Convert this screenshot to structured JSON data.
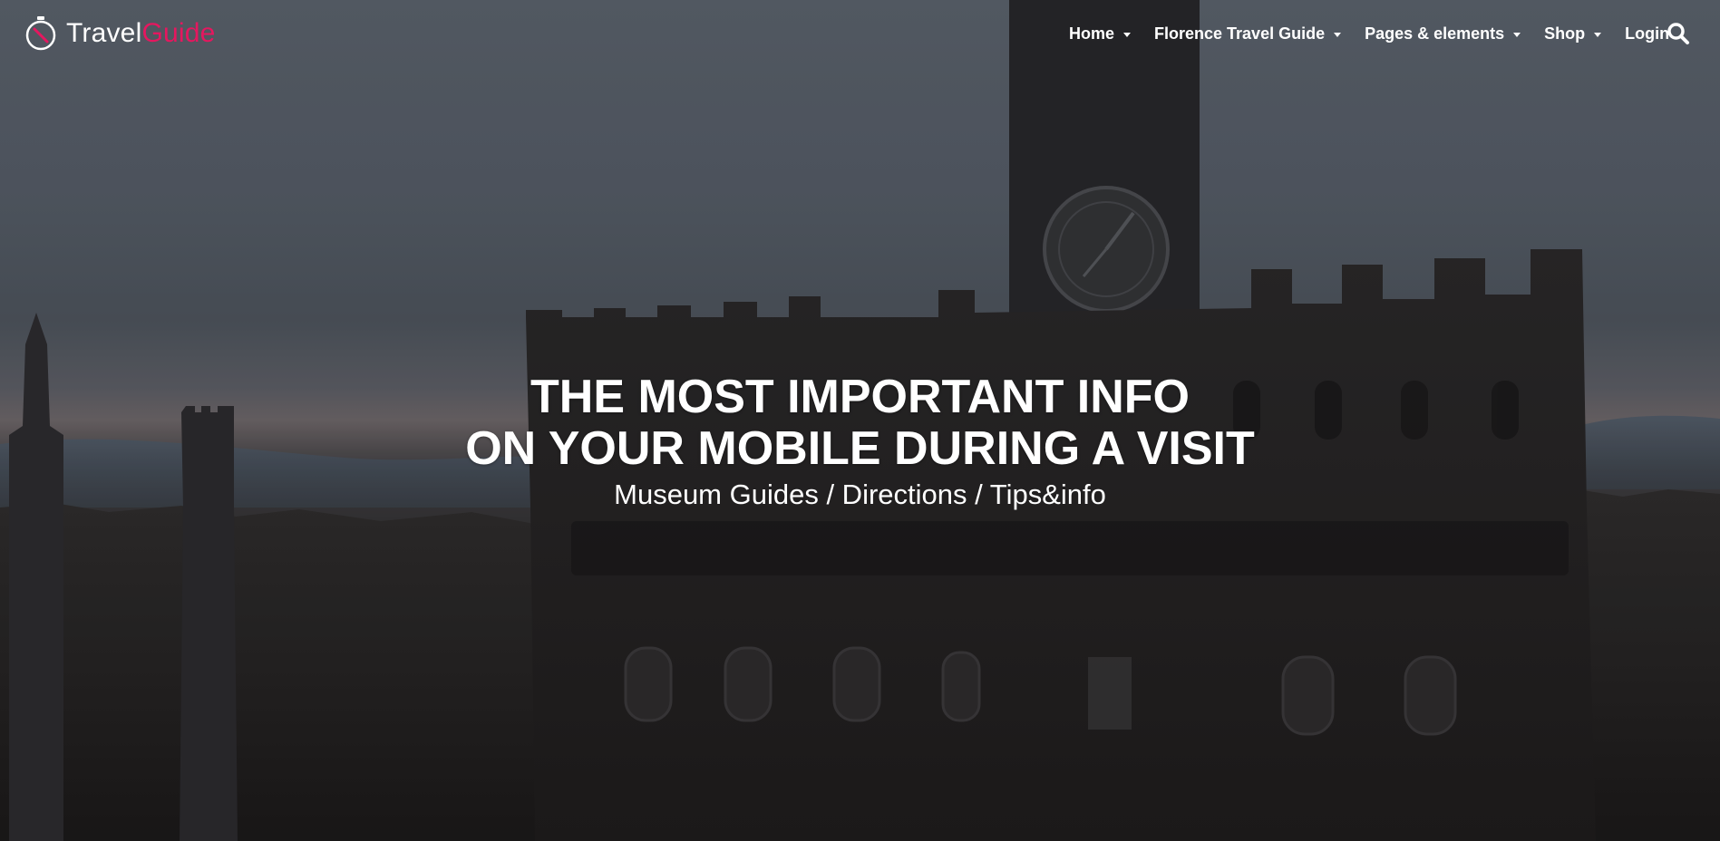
{
  "header": {
    "logo": {
      "text_part1": "Travel",
      "text_part2": "Guide",
      "icon": "compass-icon",
      "accent_color": "#e5175f"
    },
    "nav": [
      {
        "label": "Home",
        "has_dropdown": true
      },
      {
        "label": "Florence Travel Guide",
        "has_dropdown": true
      },
      {
        "label": "Pages & elements",
        "has_dropdown": true
      },
      {
        "label": "Shop",
        "has_dropdown": true
      },
      {
        "label": "Login",
        "has_dropdown": false
      }
    ],
    "search_icon": "search-icon"
  },
  "hero": {
    "headline_line1": "THE MOST IMPORTANT INFO",
    "headline_line2": "ON YOUR MOBILE DURING A VISIT",
    "subline": "Museum Guides / Directions / Tips&info"
  }
}
